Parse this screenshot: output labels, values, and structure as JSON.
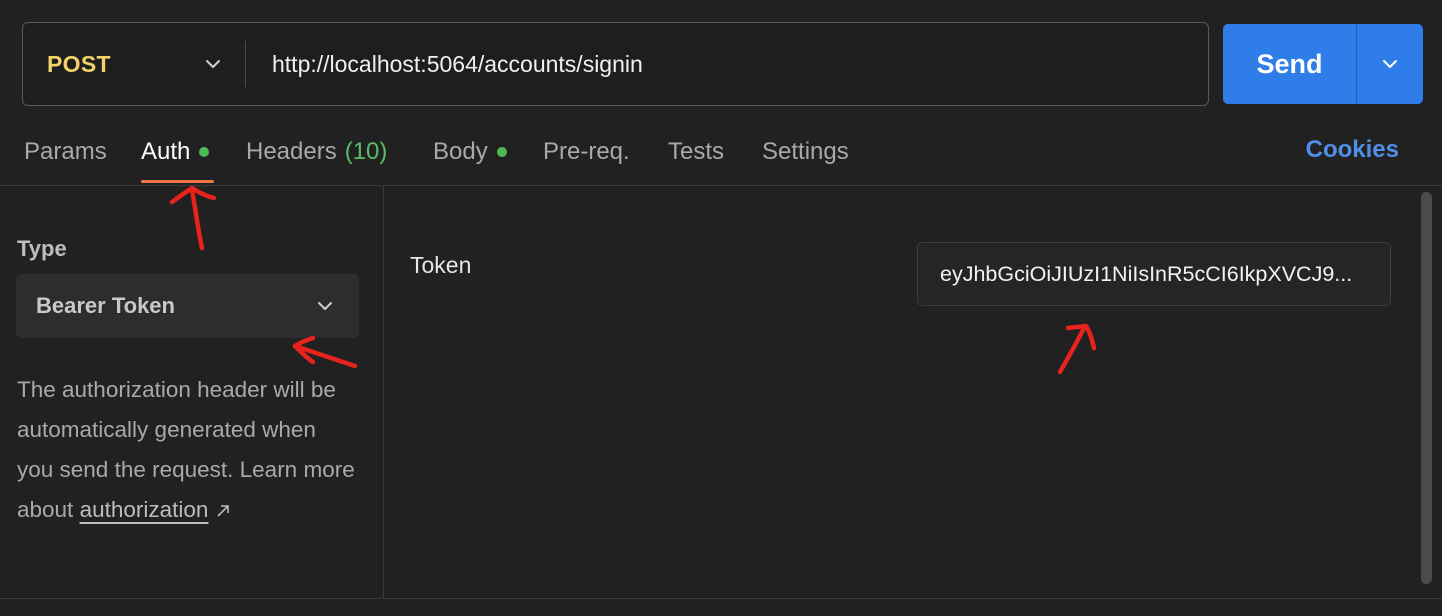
{
  "request": {
    "method": "POST",
    "url": "http://localhost:5064/accounts/signin",
    "send_label": "Send"
  },
  "tabs": [
    {
      "label": "Params"
    },
    {
      "label": "Auth",
      "active": true,
      "indicator": "green-dot"
    },
    {
      "label": "Headers",
      "count": "(10)"
    },
    {
      "label": "Body",
      "indicator": "green-dot"
    },
    {
      "label": "Pre-req."
    },
    {
      "label": "Tests"
    },
    {
      "label": "Settings"
    }
  ],
  "cookies_label": "Cookies",
  "auth": {
    "type_label": "Type",
    "type_value": "Bearer Token",
    "help_text": "The authorization header will be automatically generated when you send the request. Learn more about ",
    "help_link": "authorization",
    "token_label": "Token",
    "token_value": "eyJhbGciOiJIUzI1NiIsInR5cCI6IkpXVCJ9..."
  },
  "colors": {
    "background": "#212121",
    "method": "#f2d36b",
    "send": "#2f7de8",
    "active_tab_underline": "#f0764a",
    "indicator": "#4fba55",
    "cookies": "#4f8fe6",
    "annotation": "#e8221c"
  }
}
